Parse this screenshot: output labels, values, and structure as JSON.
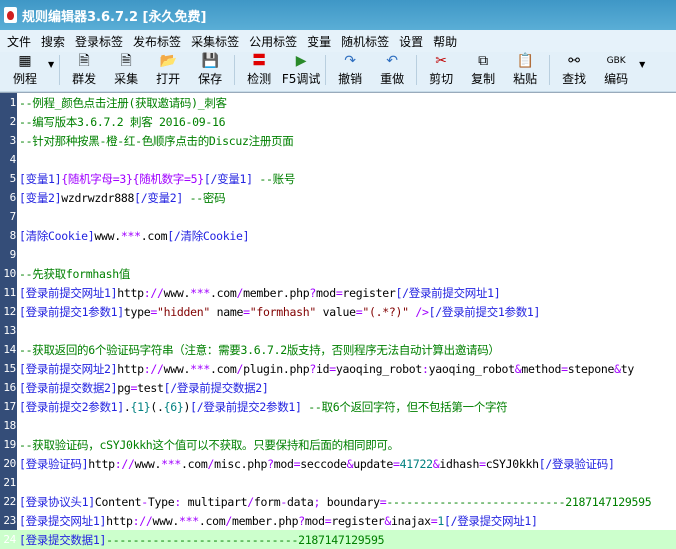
{
  "window": {
    "title": "规则编辑器3.6.7.2 [永久免费]"
  },
  "menu": [
    "文件",
    "搜索",
    "登录标签",
    "发布标签",
    "采集标签",
    "公用标签",
    "变量",
    "随机标签",
    "设置",
    "帮助"
  ],
  "toolbar": [
    {
      "label": "例程",
      "icon": "grid-icon",
      "dropdown": true
    },
    {
      "sep": true
    },
    {
      "label": "群发",
      "icon": "document-icon"
    },
    {
      "label": "采集",
      "icon": "document-icon"
    },
    {
      "label": "打开",
      "icon": "folder-open-icon"
    },
    {
      "label": "保存",
      "icon": "floppy-icon"
    },
    {
      "sep": true
    },
    {
      "label": "检测",
      "icon": "equals-red-icon"
    },
    {
      "label": "F5调试",
      "icon": "play-icon"
    },
    {
      "sep": true
    },
    {
      "label": "撤销",
      "icon": "undo-icon"
    },
    {
      "label": "重做",
      "icon": "redo-icon"
    },
    {
      "sep": true
    },
    {
      "label": "剪切",
      "icon": "scissors-icon"
    },
    {
      "label": "复制",
      "icon": "copy-icon"
    },
    {
      "label": "粘贴",
      "icon": "paste-icon"
    },
    {
      "sep": true
    },
    {
      "label": "查找",
      "icon": "binoculars-icon"
    },
    {
      "label": "编码",
      "icon_text": "GBK",
      "dropdown": true
    }
  ],
  "colors": {
    "gutter": "#344d78",
    "highlight": "#ccffcc",
    "comment": "#008000",
    "tag": "#2323e0"
  },
  "editor": {
    "current_line": 24,
    "lines": [
      [
        [
          "g",
          "--例程_颜色点击注册(获取邀请码)_刺客"
        ]
      ],
      [
        [
          "g",
          "--编写版本3.6.7.2 刺客 2016-09-16"
        ]
      ],
      [
        [
          "g",
          "--针对那种按黑-橙-红-色顺序点击的Discuz注册页面"
        ]
      ],
      [],
      [
        [
          "b",
          "[变量1]"
        ],
        [
          "m",
          "{随机字母=3}"
        ],
        [
          "m",
          "{随机数字=5}"
        ],
        [
          "b",
          "[/变量1]"
        ],
        [
          "g",
          " --账号"
        ]
      ],
      [
        [
          "b",
          "[变量2]"
        ],
        [
          "k",
          "wzdrwzdr888"
        ],
        [
          "b",
          "[/变量2]"
        ],
        [
          "g",
          " --密码"
        ]
      ],
      [],
      [
        [
          "b",
          "[清除Cookie]"
        ],
        [
          "k",
          "www."
        ],
        [
          "m",
          "***"
        ],
        [
          "k",
          ".com"
        ],
        [
          "b",
          "[/清除Cookie]"
        ]
      ],
      [],
      [
        [
          "g",
          "--先获取formhash值"
        ]
      ],
      [
        [
          "b",
          "[登录前提交网址1]"
        ],
        [
          "k",
          "http"
        ],
        [
          "m",
          "://"
        ],
        [
          "k",
          "www."
        ],
        [
          "m",
          "***"
        ],
        [
          "k",
          ".com"
        ],
        [
          "m",
          "/"
        ],
        [
          "k",
          "member.php"
        ],
        [
          "m",
          "?"
        ],
        [
          "k",
          "mod"
        ],
        [
          "m",
          "="
        ],
        [
          "k",
          "register"
        ],
        [
          "b",
          "[/登录前提交网址1]"
        ]
      ],
      [
        [
          "b",
          "[登录前提交1参数1]"
        ],
        [
          "k",
          "type"
        ],
        [
          "m",
          "="
        ],
        [
          "r",
          "\"hidden\""
        ],
        [
          "k",
          " name"
        ],
        [
          "m",
          "="
        ],
        [
          "r",
          "\"formhash\""
        ],
        [
          "k",
          " value"
        ],
        [
          "m",
          "="
        ],
        [
          "r",
          "\"(.*?)\""
        ],
        [
          "m",
          " />"
        ],
        [
          "b",
          "[/登录前提交1参数1]"
        ]
      ],
      [],
      [
        [
          "g",
          "--获取返回的6个验证码字符串（注意：需要3.6.7.2版支持，否则程序无法自动计算出邀请码）"
        ]
      ],
      [
        [
          "b",
          "[登录前提交网址2]"
        ],
        [
          "k",
          "http"
        ],
        [
          "m",
          "://"
        ],
        [
          "k",
          "www."
        ],
        [
          "m",
          "***"
        ],
        [
          "k",
          ".com"
        ],
        [
          "m",
          "/"
        ],
        [
          "k",
          "plugin.php"
        ],
        [
          "m",
          "?"
        ],
        [
          "k",
          "id"
        ],
        [
          "m",
          "="
        ],
        [
          "k",
          "yaoqing_robot"
        ],
        [
          "m",
          ":"
        ],
        [
          "k",
          "yaoqing_robot"
        ],
        [
          "m",
          "&"
        ],
        [
          "k",
          "method"
        ],
        [
          "m",
          "="
        ],
        [
          "k",
          "stepone"
        ],
        [
          "m",
          "&"
        ],
        [
          "k",
          "ty"
        ]
      ],
      [
        [
          "b",
          "[登录前提交数据2]"
        ],
        [
          "k",
          "pg"
        ],
        [
          "m",
          "="
        ],
        [
          "k",
          "test"
        ],
        [
          "b",
          "[/登录前提交数据2]"
        ]
      ],
      [
        [
          "b",
          "[登录前提交2参数1]"
        ],
        [
          "k",
          "."
        ],
        [
          "t",
          "{1}"
        ],
        [
          "k",
          "(."
        ],
        [
          "t",
          "{6}"
        ],
        [
          "k",
          ")"
        ],
        [
          "b",
          "[/登录前提交2参数1]"
        ],
        [
          "g",
          " --取6个返回字符，但不包括第一个字符"
        ]
      ],
      [],
      [
        [
          "g",
          "--获取验证码，cSYJ0kkh这个值可以不获取。只要保持和后面的相同即可。"
        ]
      ],
      [
        [
          "b",
          "[登录验证码]"
        ],
        [
          "k",
          "http"
        ],
        [
          "m",
          "://"
        ],
        [
          "k",
          "www."
        ],
        [
          "m",
          "***"
        ],
        [
          "k",
          ".com"
        ],
        [
          "m",
          "/"
        ],
        [
          "k",
          "misc.php"
        ],
        [
          "m",
          "?"
        ],
        [
          "k",
          "mod"
        ],
        [
          "m",
          "="
        ],
        [
          "k",
          "seccode"
        ],
        [
          "m",
          "&"
        ],
        [
          "k",
          "update"
        ],
        [
          "m",
          "="
        ],
        [
          "t",
          "41722"
        ],
        [
          "m",
          "&"
        ],
        [
          "k",
          "idhash"
        ],
        [
          "m",
          "="
        ],
        [
          "k",
          "cSYJ0kkh"
        ],
        [
          "b",
          "[/登录验证码]"
        ]
      ],
      [],
      [
        [
          "b",
          "[登录协议头1]"
        ],
        [
          "k",
          "Content"
        ],
        [
          "m",
          "-"
        ],
        [
          "k",
          "Type"
        ],
        [
          "m",
          ":"
        ],
        [
          "k",
          " multipart"
        ],
        [
          "m",
          "/"
        ],
        [
          "k",
          "form"
        ],
        [
          "m",
          "-"
        ],
        [
          "k",
          "data"
        ],
        [
          "m",
          ";"
        ],
        [
          "k",
          " boundary"
        ],
        [
          "m",
          "="
        ],
        [
          "g",
          "---------------------------2187147129595"
        ]
      ],
      [
        [
          "b",
          "[登录提交网址1]"
        ],
        [
          "k",
          "http"
        ],
        [
          "m",
          "://"
        ],
        [
          "k",
          "www."
        ],
        [
          "m",
          "***"
        ],
        [
          "k",
          ".com"
        ],
        [
          "m",
          "/"
        ],
        [
          "k",
          "member.php"
        ],
        [
          "m",
          "?"
        ],
        [
          "k",
          "mod"
        ],
        [
          "m",
          "="
        ],
        [
          "k",
          "register"
        ],
        [
          "m",
          "&"
        ],
        [
          "k",
          "inajax"
        ],
        [
          "m",
          "="
        ],
        [
          "t",
          "1"
        ],
        [
          "b",
          "[/登录提交网址1]"
        ]
      ],
      [
        [
          "b",
          "[登录提交数据1]"
        ],
        [
          "g",
          "-----------------------------2187147129595"
        ]
      ]
    ]
  }
}
